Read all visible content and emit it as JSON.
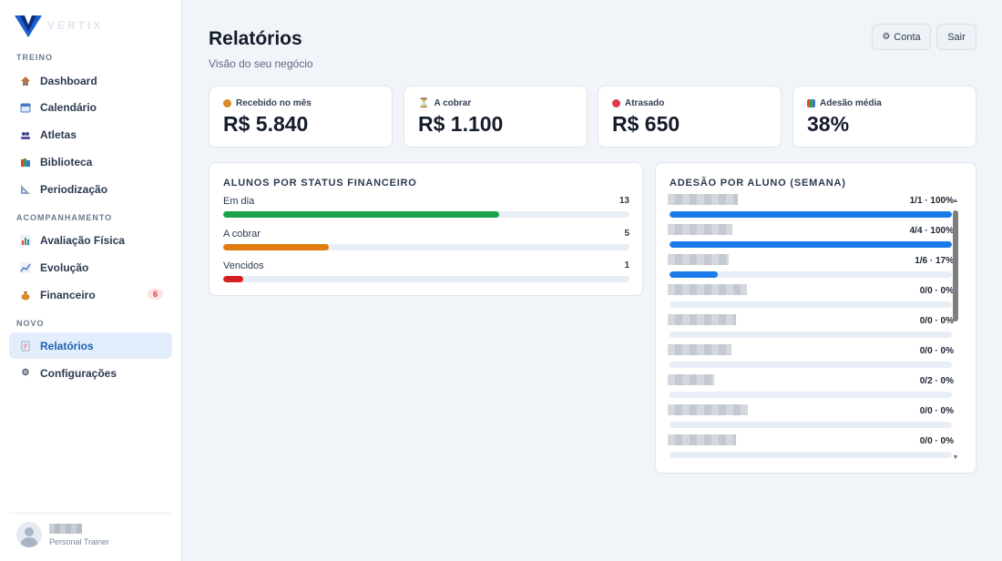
{
  "brand": {
    "name": "VERTIX"
  },
  "sidebar": {
    "sections": [
      {
        "title": "TREINO"
      },
      {
        "title": "ACOMPANHAMENTO"
      },
      {
        "title": "NOVO"
      }
    ],
    "items": [
      {
        "label": "Dashboard",
        "icon": "house-icon"
      },
      {
        "label": "Calendário",
        "icon": "calendar-icon"
      },
      {
        "label": "Atletas",
        "icon": "users-icon"
      },
      {
        "label": "Biblioteca",
        "icon": "books-icon"
      },
      {
        "label": "Periodização",
        "icon": "triangle-ruler-icon"
      },
      {
        "label": "Avaliação Física",
        "icon": "bar-chart-icon"
      },
      {
        "label": "Evolução",
        "icon": "line-chart-icon"
      },
      {
        "label": "Financeiro",
        "icon": "money-bag-icon",
        "badge": "6"
      },
      {
        "label": "Relatórios",
        "icon": "report-icon",
        "active": true
      },
      {
        "label": "Configurações",
        "icon": "gear-icon"
      }
    ],
    "user": {
      "role": "Personal Trainer"
    }
  },
  "header": {
    "title": "Relatórios",
    "subtitle": "Visão do seu negócio",
    "account_label": "Conta",
    "account_icon": "⚙",
    "logout_label": "Sair"
  },
  "kpis": [
    {
      "label": "Recebido no mês",
      "value": "R$ 5.840",
      "icon": "money-bag-icon",
      "color": "#d98a2b"
    },
    {
      "label": "A cobrar",
      "value": "R$ 1.100",
      "icon": "hourglass-icon",
      "color": "#e0a33a"
    },
    {
      "label": "Atrasado",
      "value": "R$ 650",
      "icon": "red-circle-icon",
      "color": "#e03b4b"
    },
    {
      "label": "Adesão média",
      "value": "38%",
      "icon": "bar-chart-icon",
      "color": "#4a78c9"
    }
  ],
  "status_card": {
    "title": "ALUNOS POR STATUS FINANCEIRO",
    "rows": [
      {
        "label": "Em dia",
        "count": "13",
        "fraction": 0.68,
        "color": "#1aa34a"
      },
      {
        "label": "A cobrar",
        "count": "5",
        "fraction": 0.26,
        "color": "#e07b0e"
      },
      {
        "label": "Vencidos",
        "count": "1",
        "fraction": 0.05,
        "color": "#d42020"
      }
    ]
  },
  "adesao_card": {
    "title": "ADESÃO POR ALUNO (SEMANA)",
    "rows": [
      {
        "value": "1/1 · 100%",
        "fraction": 1.0
      },
      {
        "value": "4/4 · 100%",
        "fraction": 1.0
      },
      {
        "value": "1/6 · 17%",
        "fraction": 0.17
      },
      {
        "value": "0/0 · 0%",
        "fraction": 0
      },
      {
        "value": "0/0 · 0%",
        "fraction": 0
      },
      {
        "value": "0/0 · 0%",
        "fraction": 0
      },
      {
        "value": "0/2 · 0%",
        "fraction": 0
      },
      {
        "value": "0/0 · 0%",
        "fraction": 0
      },
      {
        "value": "0/0 · 0%",
        "fraction": 0
      }
    ]
  }
}
